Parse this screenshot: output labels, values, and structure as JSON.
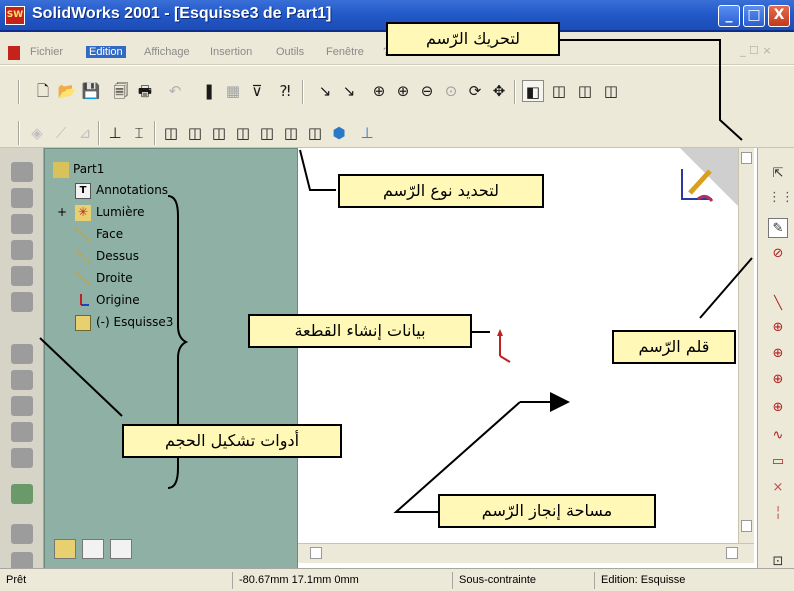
{
  "window": {
    "title": "SolidWorks 2001 - [Esquisse3 de Part1]",
    "logo": "SW",
    "controls": {
      "minimize": "_",
      "maximize": "□",
      "close": "X"
    }
  },
  "menu": {
    "items": [
      "Fichier",
      "Edition",
      "Affichage",
      "Insertion",
      "Outils",
      "Fenêtre",
      "?"
    ],
    "mdi_controls": "_ ☐ ×"
  },
  "tree": {
    "items": [
      {
        "label": "Part1",
        "icon": "part-icon"
      },
      {
        "label": "Annotations",
        "icon": "annotations-icon"
      },
      {
        "label": "Lumière",
        "icon": "light-icon",
        "expand": "+"
      },
      {
        "label": "Face",
        "icon": "plane-icon"
      },
      {
        "label": "Dessus",
        "icon": "plane-icon"
      },
      {
        "label": "Droite",
        "icon": "plane-icon"
      },
      {
        "label": "Origine",
        "icon": "origin-icon"
      },
      {
        "label": "(-) Esquisse3",
        "icon": "sketch-icon"
      }
    ]
  },
  "status": {
    "state": "Prêt",
    "coords": "-80.67mm  17.1mm   0mm",
    "constraint": "Sous-contrainte",
    "mode": "Edition: Esquisse"
  },
  "callouts": {
    "view_tools": "لتحريك الرّسم",
    "drawing_type": "لتحديد نوع الرّسم",
    "part_data": "بيانات إنشاء القطعة",
    "sketch_pen": "قلم الرّسم",
    "volume_tools": "أدوات تشكيل الحجم",
    "drawing_area": "مساحة إنجاز الرّسم"
  },
  "colors": {
    "titlebar": "#2258c8",
    "tree_background": "#8fb0a4",
    "callout_fill": "#fff8b6",
    "chrome": "#ece9d8"
  }
}
